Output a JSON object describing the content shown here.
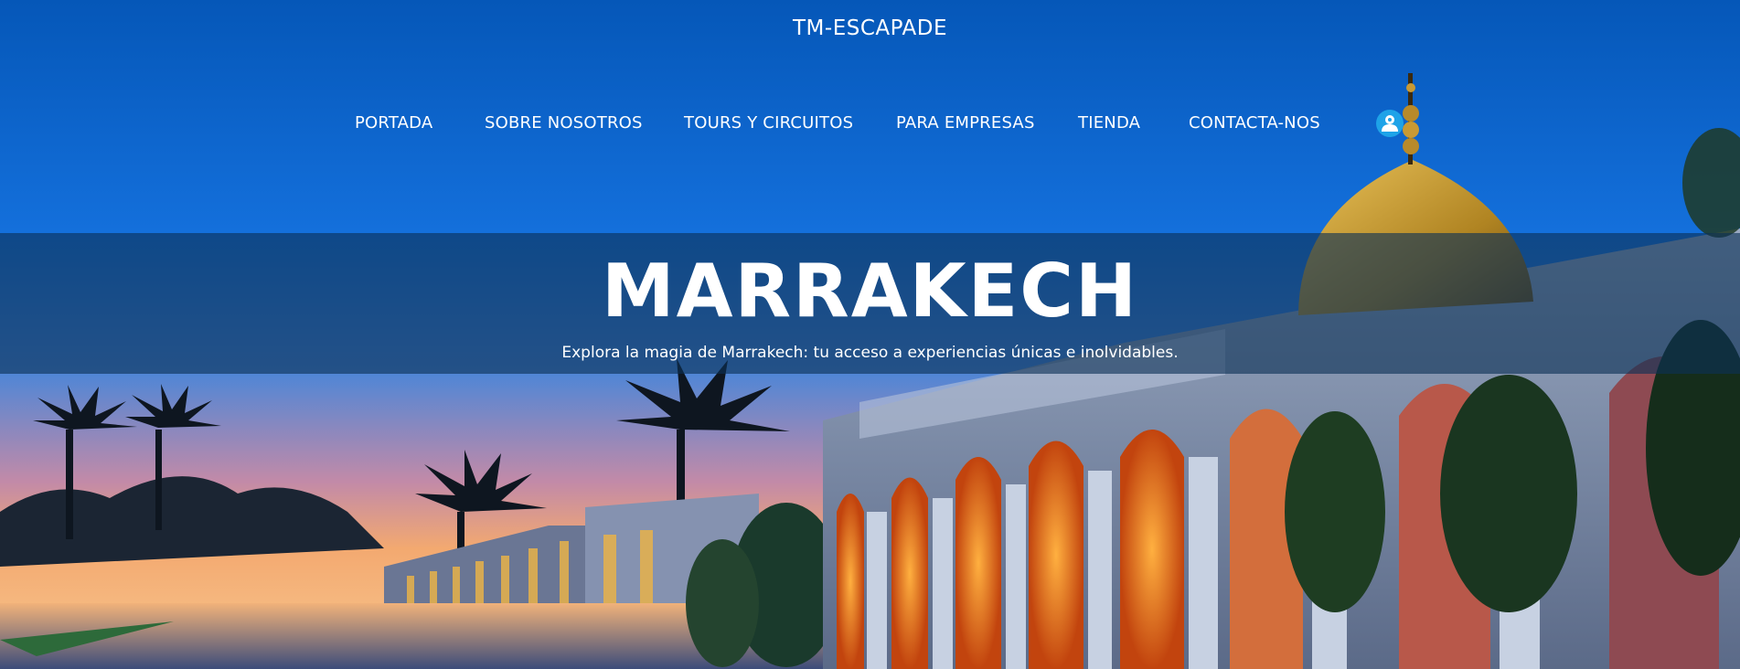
{
  "site": {
    "title": "TM-ESCAPADE"
  },
  "nav": {
    "items": [
      {
        "label": "PORTADA"
      },
      {
        "label": "SOBRE NOSOTROS"
      },
      {
        "label": "TOURS Y CIRCUITOS"
      },
      {
        "label": "PARA EMPRESAS"
      },
      {
        "label": "TIENDA"
      },
      {
        "label": "CONTACTA-NOS"
      }
    ],
    "account_icon": "user-icon"
  },
  "hero": {
    "headline": "MARRAKECH",
    "subheadline": "Explora la magia de Marrakech: tu acceso a experiencias únicas e inolvidables."
  },
  "colors": {
    "sky_top": "#0561c4",
    "sky_mid": "#1a77e2",
    "band": "#0c3056",
    "account_bg": "#1ea3e8"
  }
}
